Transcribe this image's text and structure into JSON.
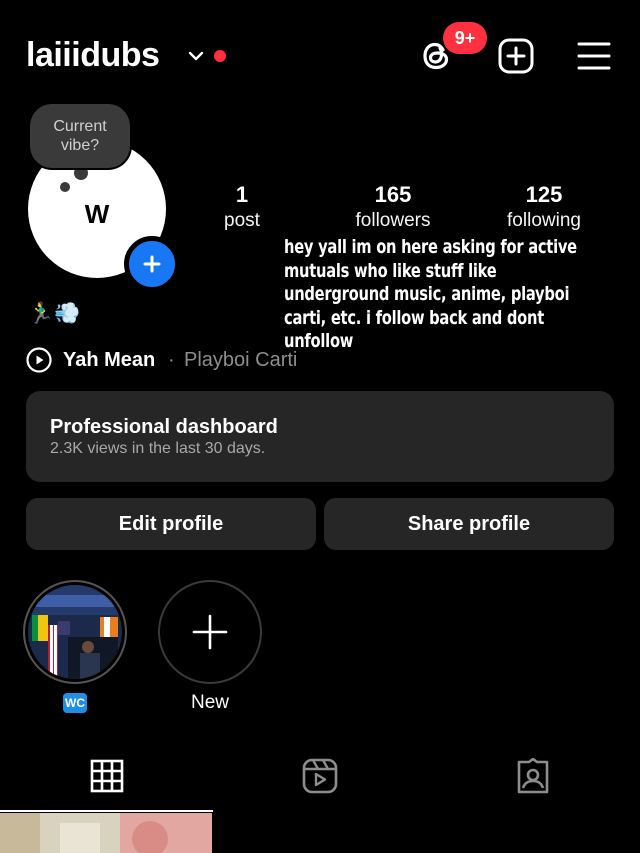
{
  "header": {
    "username": "laiiidubs",
    "notification_badge": "9+",
    "icons": [
      "chevron-down-icon",
      "threads-icon",
      "plus-square-icon",
      "hamburger-menu-icon"
    ]
  },
  "profile": {
    "avatar_letter": "W",
    "vibe_prompt_line1": "Current",
    "vibe_prompt_line2": "vibe?",
    "emojis": "🏃‍♂️💨"
  },
  "stats": {
    "posts": {
      "value": "1",
      "label": "post"
    },
    "followers": {
      "value": "165",
      "label": "followers"
    },
    "following": {
      "value": "125",
      "label": "following"
    }
  },
  "bio_overlay": {
    "lines": [
      "hey yall im on here asking for active",
      "mutuals who like stuff like",
      "underground music, anime, playboi",
      "carti, etc. i follow back and dont",
      "unfollow"
    ]
  },
  "music": {
    "title": "Yah Mean",
    "separator": "·",
    "artist": "Playboi Carti"
  },
  "dashboard": {
    "title": "Professional dashboard",
    "subtitle": "2.3K views in the last 30 days."
  },
  "buttons": {
    "edit_profile": "Edit profile",
    "share_profile": "Share profile"
  },
  "highlights": {
    "first_label": "WC",
    "new_label": "New"
  },
  "tabs": [
    "grid-icon",
    "reels-icon",
    "tagged-icon"
  ],
  "colors": {
    "background": "#000000",
    "surface": "#262626",
    "accent_blue": "#1877f2",
    "badge_red": "#ff3040",
    "muted_text": "#8e8e8e"
  }
}
